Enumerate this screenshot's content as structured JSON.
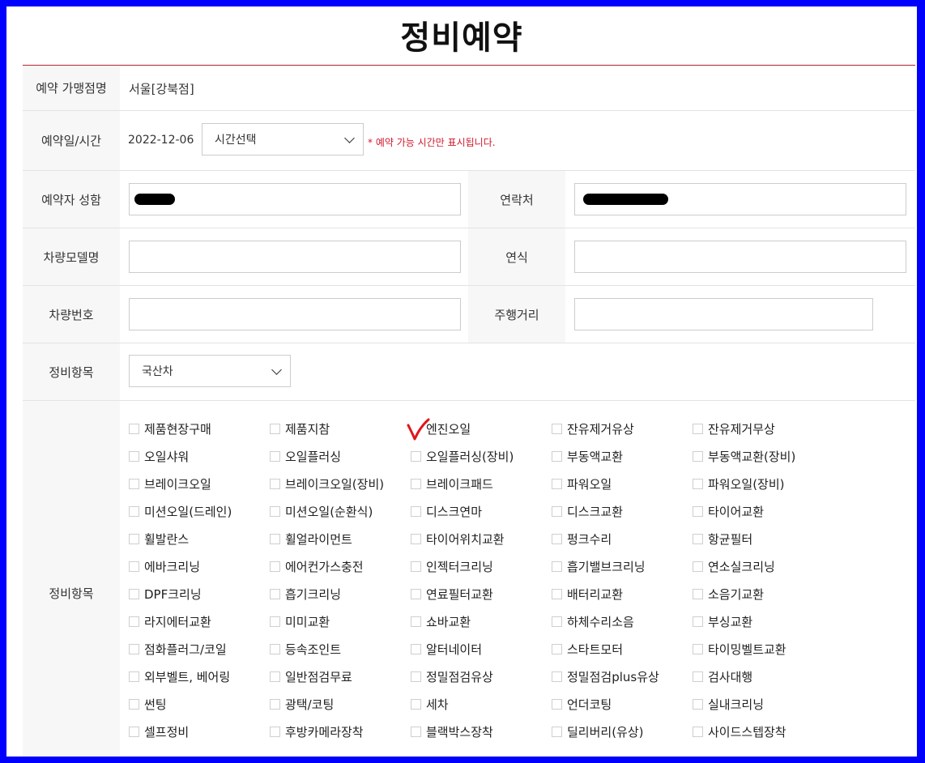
{
  "page": {
    "title": "정비예약"
  },
  "store": {
    "label": "예약 가맹점명",
    "value": "서울[강북점]"
  },
  "datetime": {
    "label": "예약일/시간",
    "date": "2022-12-06",
    "time_select": "시간선택",
    "note": "* 예약 가능 시간만 표시됩니다."
  },
  "name": {
    "label": "예약자 성함"
  },
  "phone": {
    "label": "연락처"
  },
  "model": {
    "label": "차량모델명"
  },
  "year": {
    "label": "연식"
  },
  "plate": {
    "label": "차량번호"
  },
  "mileage": {
    "label": "주행거리"
  },
  "category": {
    "label": "정비항목",
    "select": "국산차"
  },
  "services": {
    "label": "정비항목",
    "checked": [
      "엔진오일"
    ],
    "rows": [
      [
        "제품현장구매",
        "제품지참",
        "엔진오일",
        "잔유제거유상",
        "잔유제거무상"
      ],
      [
        "오일샤워",
        "오일플러싱",
        "오일플러싱(장비)",
        "부동액교환",
        "부동액교환(장비)"
      ],
      [
        "브레이크오일",
        "브레이크오일(장비)",
        "브레이크패드",
        "파워오일",
        "파워오일(장비)"
      ],
      [
        "미션오일(드레인)",
        "미션오일(순환식)",
        "디스크연마",
        "디스크교환",
        "타이어교환"
      ],
      [
        "휠발란스",
        "휠얼라이먼트",
        "타이어위치교환",
        "펑크수리",
        "항균필터"
      ],
      [
        "에바크리닝",
        "에어컨가스충전",
        "인젝터크리닝",
        "흡기밸브크리닝",
        "연소실크리닝"
      ],
      [
        "DPF크리닝",
        "흡기크리닝",
        "연료필터교환",
        "배터리교환",
        "소음기교환"
      ],
      [
        "라지에터교환",
        "미미교환",
        "쇼바교환",
        "하체수리소음",
        "부싱교환"
      ],
      [
        "점화플러그/코일",
        "등속조인트",
        "알터네이터",
        "스타트모터",
        "타이밍벨트교환"
      ],
      [
        "외부벨트, 베어링",
        "일반점검무료",
        "정밀점검유상",
        "정밀점검plus유상",
        "검사대행"
      ],
      [
        "썬팅",
        "광택/코팅",
        "세차",
        "언더코팅",
        "실내크리닝"
      ],
      [
        "셀프정비",
        "후방카메라장착",
        "블랙박스장착",
        "딜리버리(유상)",
        "사이드스텝장착"
      ]
    ]
  }
}
